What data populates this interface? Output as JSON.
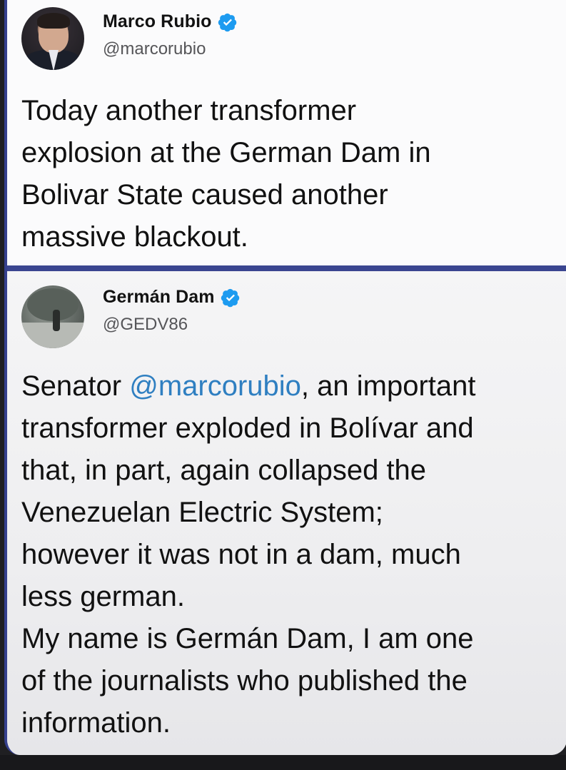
{
  "tweet_1": {
    "name": "Marco Rubio",
    "handle": "@marcorubio",
    "avatar_icon": "profile-photo-icon",
    "verified_icon": "verified-badge-icon",
    "body": "Today another transformer\nexplosion at the German Dam in\nBolivar State caused another\nmassive blackout."
  },
  "tweet_2": {
    "name": "Germán Dam",
    "handle": "@GEDV86",
    "avatar_icon": "profile-photo-icon",
    "verified_icon": "verified-badge-icon",
    "body_prefix": "Senator ",
    "mention": "@marcorubio",
    "body_suffix": ", an important\ntransformer exploded in Bolívar and\nthat, in part, again collapsed the\nVenezuelan Electric System;\nhowever it was not in a dam, much\nless german.\nMy name is Germán Dam, I am one\nof the journalists who published the\ninformation."
  },
  "colors": {
    "accent_border": "#35408e",
    "mention": "#2f7fc1",
    "verified": "#1d9bf0"
  }
}
